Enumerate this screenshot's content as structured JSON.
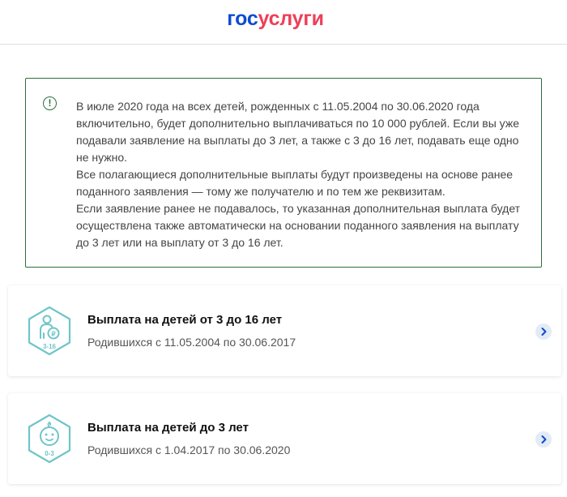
{
  "header": {
    "logo_part1": "гос",
    "logo_part2": "услуги"
  },
  "notice": {
    "icon": "exclamation-circle-icon",
    "paragraphs": [
      "В июле 2020 года на всех детей, рожденных с 11.05.2004 по 30.06.2020 года включительно, будет дополнительно выплачиваться по 10 000 рублей. Если вы уже подавали заявление на выплаты до 3 лет, а также с 3 до 16 лет, подавать еще одно не нужно.",
      "Все полагающиеся дополнительные выплаты будут произведены на основе ранее поданного заявления — тому же получателю и по тем же реквизитам.",
      "Если заявление ранее не подавалось, то указанная дополнительная выплата будет осуществлена также автоматически на основании поданного заявления на выплату до 3 лет или на выплату от 3 до 16 лет."
    ]
  },
  "cards": [
    {
      "title": "Выплата на детей от 3 до 16 лет",
      "subtitle": "Родившихся с 11.05.2004 по 30.06.2017",
      "icon_label": "3-16",
      "icon": "child-with-coin-icon"
    },
    {
      "title": "Выплата на детей до 3 лет",
      "subtitle": "Родившихся с 1.04.2017 по 30.06.2020",
      "icon_label": "0-3",
      "icon": "baby-face-icon"
    }
  ],
  "colors": {
    "logo_blue": "#0d4cd3",
    "logo_red": "#ee3f58",
    "notice_border": "#2c6e3a",
    "icon_teal": "#6fc5c8",
    "chevron_bg": "#e3ebf6",
    "chevron": "#0d4cd3"
  }
}
